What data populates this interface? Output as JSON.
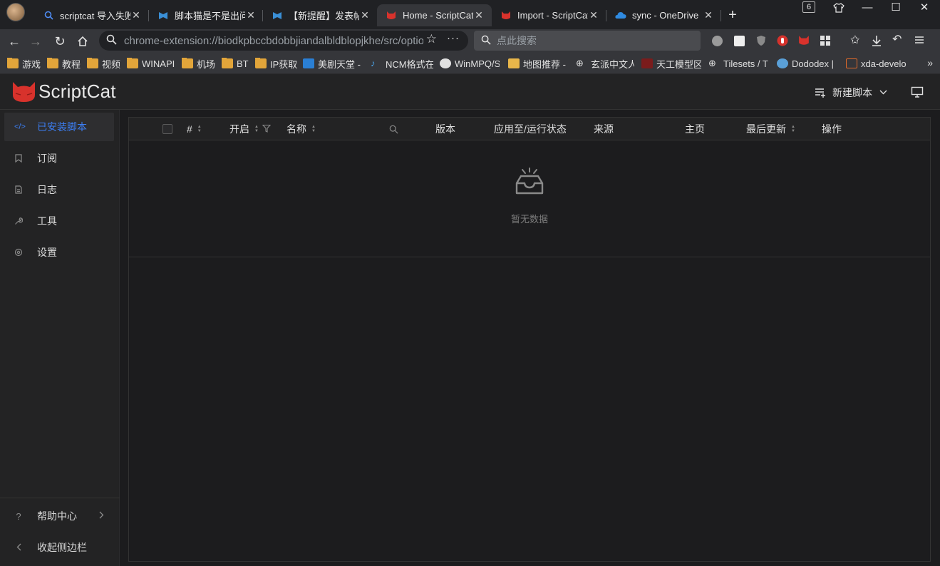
{
  "browser": {
    "tabs": [
      {
        "label": "scriptcat 导入失败",
        "icon": "search-icon",
        "active": false
      },
      {
        "label": "脚本猫是不是出问题了",
        "icon": "forum-icon",
        "active": false
      },
      {
        "label": "【新提醒】发表帖子",
        "icon": "forum-icon",
        "active": false
      },
      {
        "label": "Home - ScriptCat",
        "icon": "scriptcat-icon",
        "active": true
      },
      {
        "label": "Import - ScriptCat",
        "icon": "scriptcat-icon",
        "active": false
      },
      {
        "label": "sync - OneDrive",
        "icon": "onedrive-icon",
        "active": false
      }
    ],
    "tab_count": "6",
    "url": "chrome-extension://biodkpbccbdobbjiandalbldblopjkhe/src/options.html#/",
    "search_placeholder": "点此搜索",
    "bookmarks": [
      {
        "label": "游戏",
        "icon": "folder-icon"
      },
      {
        "label": "教程",
        "icon": "folder-icon"
      },
      {
        "label": "视频",
        "icon": "folder-icon"
      },
      {
        "label": "WINAPI",
        "icon": "folder-icon"
      },
      {
        "label": "机场",
        "icon": "folder-icon"
      },
      {
        "label": "BT",
        "icon": "folder-icon"
      },
      {
        "label": "IP获取",
        "icon": "folder-icon"
      },
      {
        "label": "美剧天堂 -",
        "icon": "site-icon"
      },
      {
        "label": "NCM格式在",
        "icon": "music-icon"
      },
      {
        "label": "WinMPQ/S",
        "icon": "github-icon"
      },
      {
        "label": "地图推荐 -",
        "icon": "site-icon"
      },
      {
        "label": "玄派中文人",
        "icon": "globe-icon"
      },
      {
        "label": "天工模型区",
        "icon": "site-icon"
      },
      {
        "label": "Tilesets / T",
        "icon": "globe-icon"
      },
      {
        "label": "Dododex |",
        "icon": "site-icon"
      },
      {
        "label": "xda-develo",
        "icon": "site-icon"
      }
    ]
  },
  "app": {
    "title": "ScriptCat",
    "new_script_label": "新建脚本"
  },
  "sidebar": {
    "items": [
      {
        "label": "已安装脚本",
        "icon": "code-icon",
        "active": true
      },
      {
        "label": "订阅",
        "icon": "bookmark-icon",
        "active": false
      },
      {
        "label": "日志",
        "icon": "file-icon",
        "active": false
      },
      {
        "label": "工具",
        "icon": "tool-icon",
        "active": false
      },
      {
        "label": "设置",
        "icon": "gear-icon",
        "active": false
      }
    ],
    "footer": {
      "help_label": "帮助中心",
      "collapse_label": "收起侧边栏"
    }
  },
  "table": {
    "columns": {
      "index": "#",
      "enabled": "开启",
      "name": "名称",
      "version": "版本",
      "apply_status": "应用至/运行状态",
      "source": "来源",
      "homepage": "主页",
      "last_update": "最后更新",
      "actions": "操作"
    },
    "empty_text": "暂无数据"
  },
  "colors": {
    "accent": "#3c7ef3",
    "background": "#1c1c1e",
    "panel": "#232324"
  }
}
